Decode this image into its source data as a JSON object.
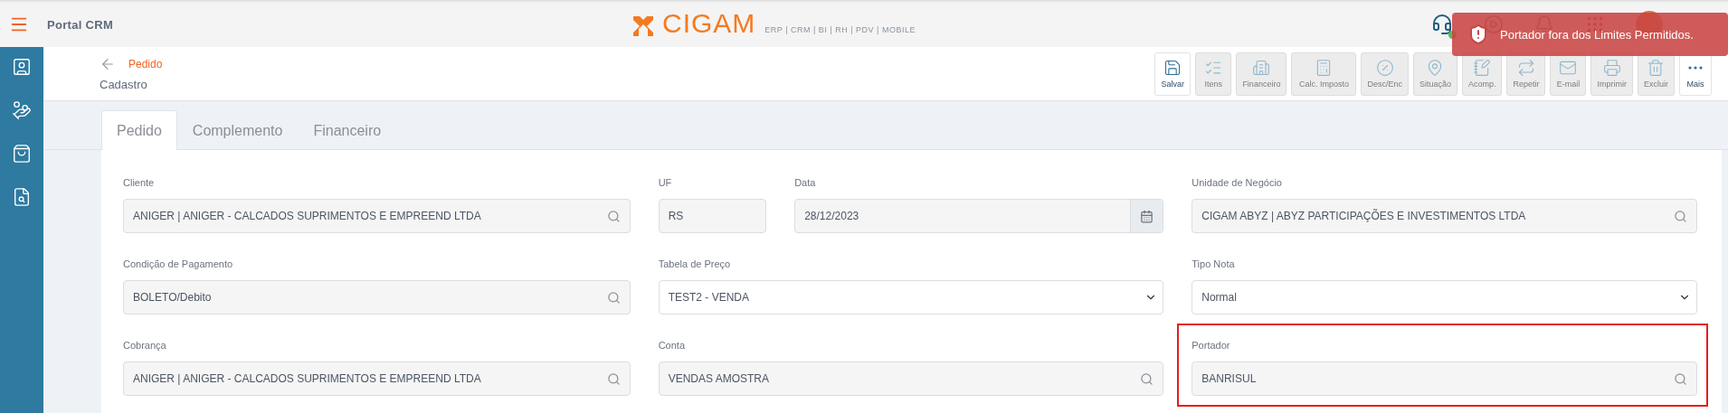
{
  "topbar": {
    "app_title": "Portal CRM",
    "logo": {
      "name": "CIGAM",
      "tagline": "ERP | CRM | BI | RH | PDV | MOBILE"
    },
    "online": true
  },
  "breadcrumb": {
    "section": "Pedido",
    "page": "Cadastro"
  },
  "toolbar": [
    {
      "label": "Salvar",
      "disabled": false
    },
    {
      "label": "Itens",
      "disabled": true
    },
    {
      "label": "Financeiro",
      "disabled": true
    },
    {
      "label": "Calc. Imposto",
      "disabled": true
    },
    {
      "label": "Desc/Enc",
      "disabled": true
    },
    {
      "label": "Situação",
      "disabled": true
    },
    {
      "label": "Acomp.",
      "disabled": true
    },
    {
      "label": "Repetir",
      "disabled": true
    },
    {
      "label": "E-mail",
      "disabled": true
    },
    {
      "label": "Imprimir",
      "disabled": true
    },
    {
      "label": "Excluir",
      "disabled": true
    },
    {
      "label": "Mais",
      "disabled": false
    }
  ],
  "tabs": [
    {
      "label": "Pedido",
      "selected": true
    },
    {
      "label": "Complemento",
      "selected": false
    },
    {
      "label": "Financeiro",
      "selected": false
    }
  ],
  "form": {
    "rows": [
      [
        {
          "label": "Cliente",
          "value": "ANIGER | ANIGER - CALCADOS SUPRIMENTOS E EMPREEND LTDA",
          "kind": "search"
        },
        {
          "label": "UF",
          "value": "RS",
          "kind": "text"
        },
        {
          "label": "Data",
          "value": "28/12/2023",
          "kind": "date"
        },
        {
          "label": "Unidade de Negócio",
          "value": "CIGAM ABYZ | ABYZ PARTICIPAÇÕES E INVESTIMENTOS LTDA",
          "kind": "search"
        }
      ],
      [
        {
          "label": "Condição de Pagamento",
          "value": "BOLETO/Debito",
          "kind": "search"
        },
        {
          "label": "Tabela de Preço",
          "value": "TEST2 - VENDA",
          "kind": "select"
        },
        {
          "label": "Tipo Nota",
          "value": "Normal",
          "kind": "select"
        }
      ],
      [
        {
          "label": "Cobrança",
          "value": "ANIGER | ANIGER - CALCADOS SUPRIMENTOS E EMPREEND LTDA",
          "kind": "search"
        },
        {
          "label": "Conta",
          "value": "VENDAS AMOSTRA",
          "kind": "search"
        },
        {
          "label": "Portador",
          "value": "BANRISUL",
          "kind": "search",
          "highlighted": true
        }
      ]
    ]
  },
  "toast": {
    "message": "Portador fora dos Limites Permitidos."
  }
}
